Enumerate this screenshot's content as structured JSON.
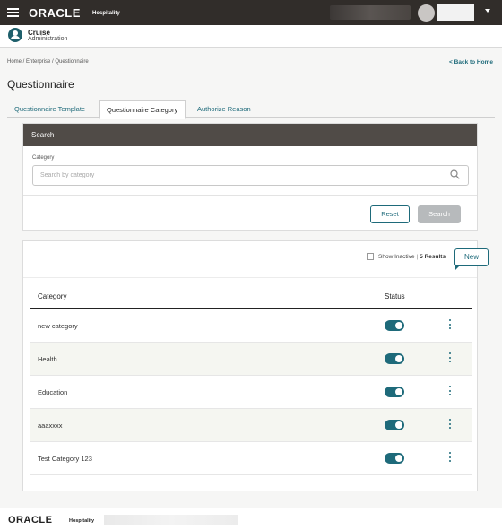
{
  "header": {
    "logo": "ORACLE",
    "logo_suffix": "Hospitality",
    "context_title": "Cruise",
    "context_subtitle": "Administration"
  },
  "breadcrumb": "Home / Enterprise / Questionnaire",
  "back_link": "< Back to Home",
  "page_title": "Questionnaire",
  "tabs": [
    {
      "label": "Questionnaire Template",
      "active": false
    },
    {
      "label": "Questionnaire Category",
      "active": true
    },
    {
      "label": "Authorize Reason",
      "active": false
    }
  ],
  "search": {
    "title": "Search",
    "field_label": "Category",
    "placeholder": "Search by category",
    "reset_label": "Reset",
    "search_label": "Search"
  },
  "results": {
    "show_inactive_label": "Show Inactive",
    "count_label": "5 Results",
    "new_label": "New",
    "columns": {
      "category": "Category",
      "status": "Status"
    },
    "rows": [
      {
        "category": "new category",
        "active": true
      },
      {
        "category": "Health",
        "active": true
      },
      {
        "category": "Education",
        "active": true
      },
      {
        "category": "aaaxxxx",
        "active": true
      },
      {
        "category": "Test Category 123",
        "active": true
      }
    ]
  },
  "footer": {
    "logo": "ORACLE",
    "logo_suffix": "Hospitality"
  },
  "colors": {
    "topbar": "#312d2a",
    "accent": "#1e6a7a",
    "search_header": "#504b47"
  }
}
